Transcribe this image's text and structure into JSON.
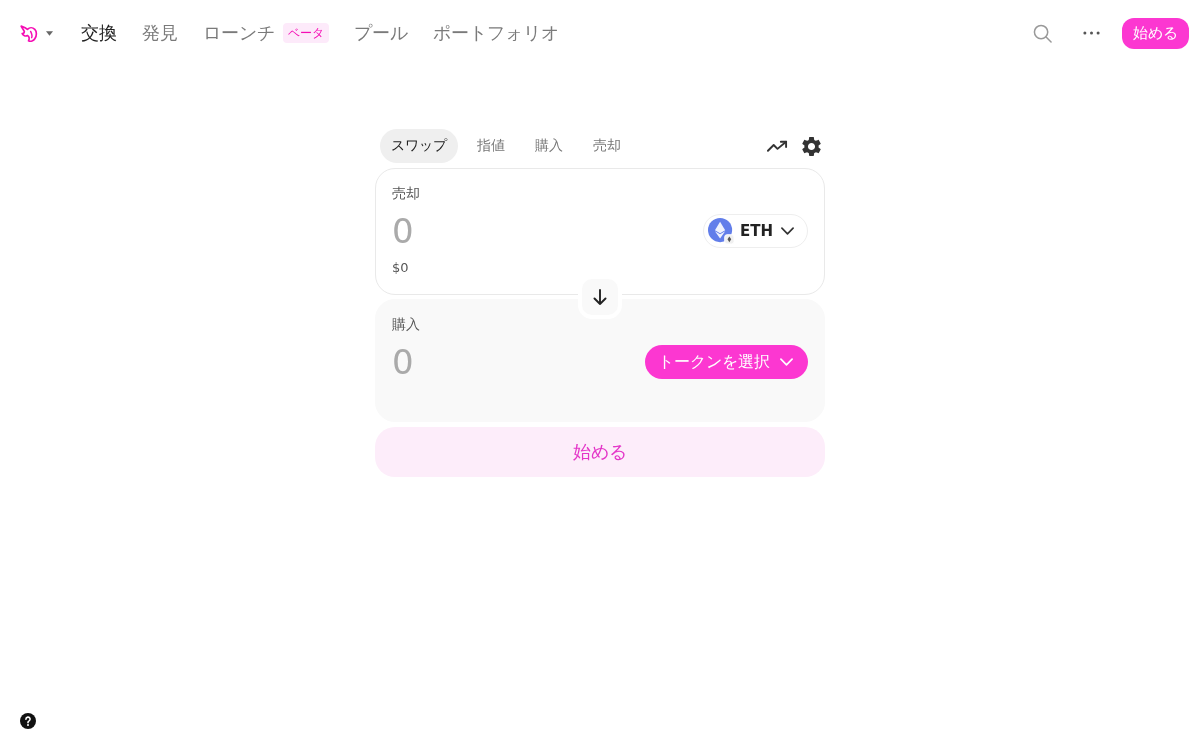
{
  "nav": {
    "items": [
      {
        "label": "交換",
        "selected": true
      },
      {
        "label": "発見",
        "selected": false
      },
      {
        "label": "ローンチ",
        "selected": false,
        "badge": "ベータ"
      },
      {
        "label": "プール",
        "selected": false
      },
      {
        "label": "ポートフォリオ",
        "selected": false
      }
    ],
    "cta": "始める"
  },
  "swap": {
    "tabs": [
      {
        "label": "スワップ",
        "selected": true
      },
      {
        "label": "指値",
        "selected": false
      },
      {
        "label": "購入",
        "selected": false
      },
      {
        "label": "売却",
        "selected": false
      }
    ],
    "sell": {
      "label": "売却",
      "placeholder": "0",
      "fiat": "$0",
      "token": "ETH"
    },
    "buy": {
      "label": "購入",
      "placeholder": "0",
      "token_select": "トークンを選択"
    },
    "submit": "始める"
  }
}
